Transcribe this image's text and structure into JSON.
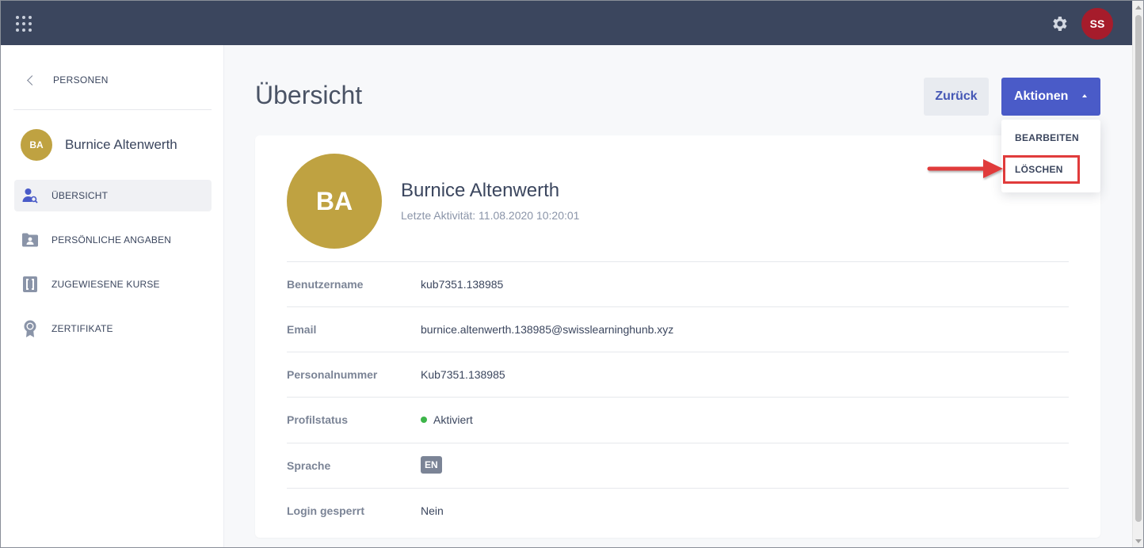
{
  "topbar": {
    "user_initials": "SS"
  },
  "sidebar": {
    "back_label": "PERSONEN",
    "person": {
      "initials": "BA",
      "name": "Burnice Altenwerth"
    },
    "items": [
      {
        "label": "ÜBERSICHT",
        "icon": "person-search-icon",
        "active": true
      },
      {
        "label": "PERSÖNLICHE ANGABEN",
        "icon": "folder-user-icon",
        "active": false
      },
      {
        "label": "ZUGEWIESENE KURSE",
        "icon": "course-bracket-icon",
        "active": false
      },
      {
        "label": "ZERTIFIKATE",
        "icon": "ribbon-badge-icon",
        "active": false
      }
    ]
  },
  "main": {
    "title": "Übersicht",
    "back_button": "Zurück",
    "actions_button": "Aktionen",
    "actions_menu": [
      {
        "label": "BEARBEITEN"
      },
      {
        "label": "LÖSCHEN",
        "highlighted": true
      }
    ]
  },
  "profile": {
    "initials": "BA",
    "name": "Burnice Altenwerth",
    "last_activity": "Letzte Aktivität: 11.08.2020 10:20:01",
    "fields": [
      {
        "label": "Benutzername",
        "value": "kub7351.138985"
      },
      {
        "label": "Email",
        "value": "burnice.altenwerth.138985@swisslearninghunb.xyz"
      },
      {
        "label": "Personalnummer",
        "value": "Kub7351.138985"
      },
      {
        "label": "Profilstatus",
        "value": "Aktiviert"
      },
      {
        "label": "Sprache",
        "value": "EN"
      },
      {
        "label": "Login gesperrt",
        "value": "Nein"
      }
    ]
  },
  "colors": {
    "topbar": "#3b465e",
    "accent": "#4a5bc8",
    "avatar_gold": "#bfa241",
    "user_avatar": "#a61c2b",
    "status_active": "#3db54a",
    "highlight": "#e03b3b"
  }
}
